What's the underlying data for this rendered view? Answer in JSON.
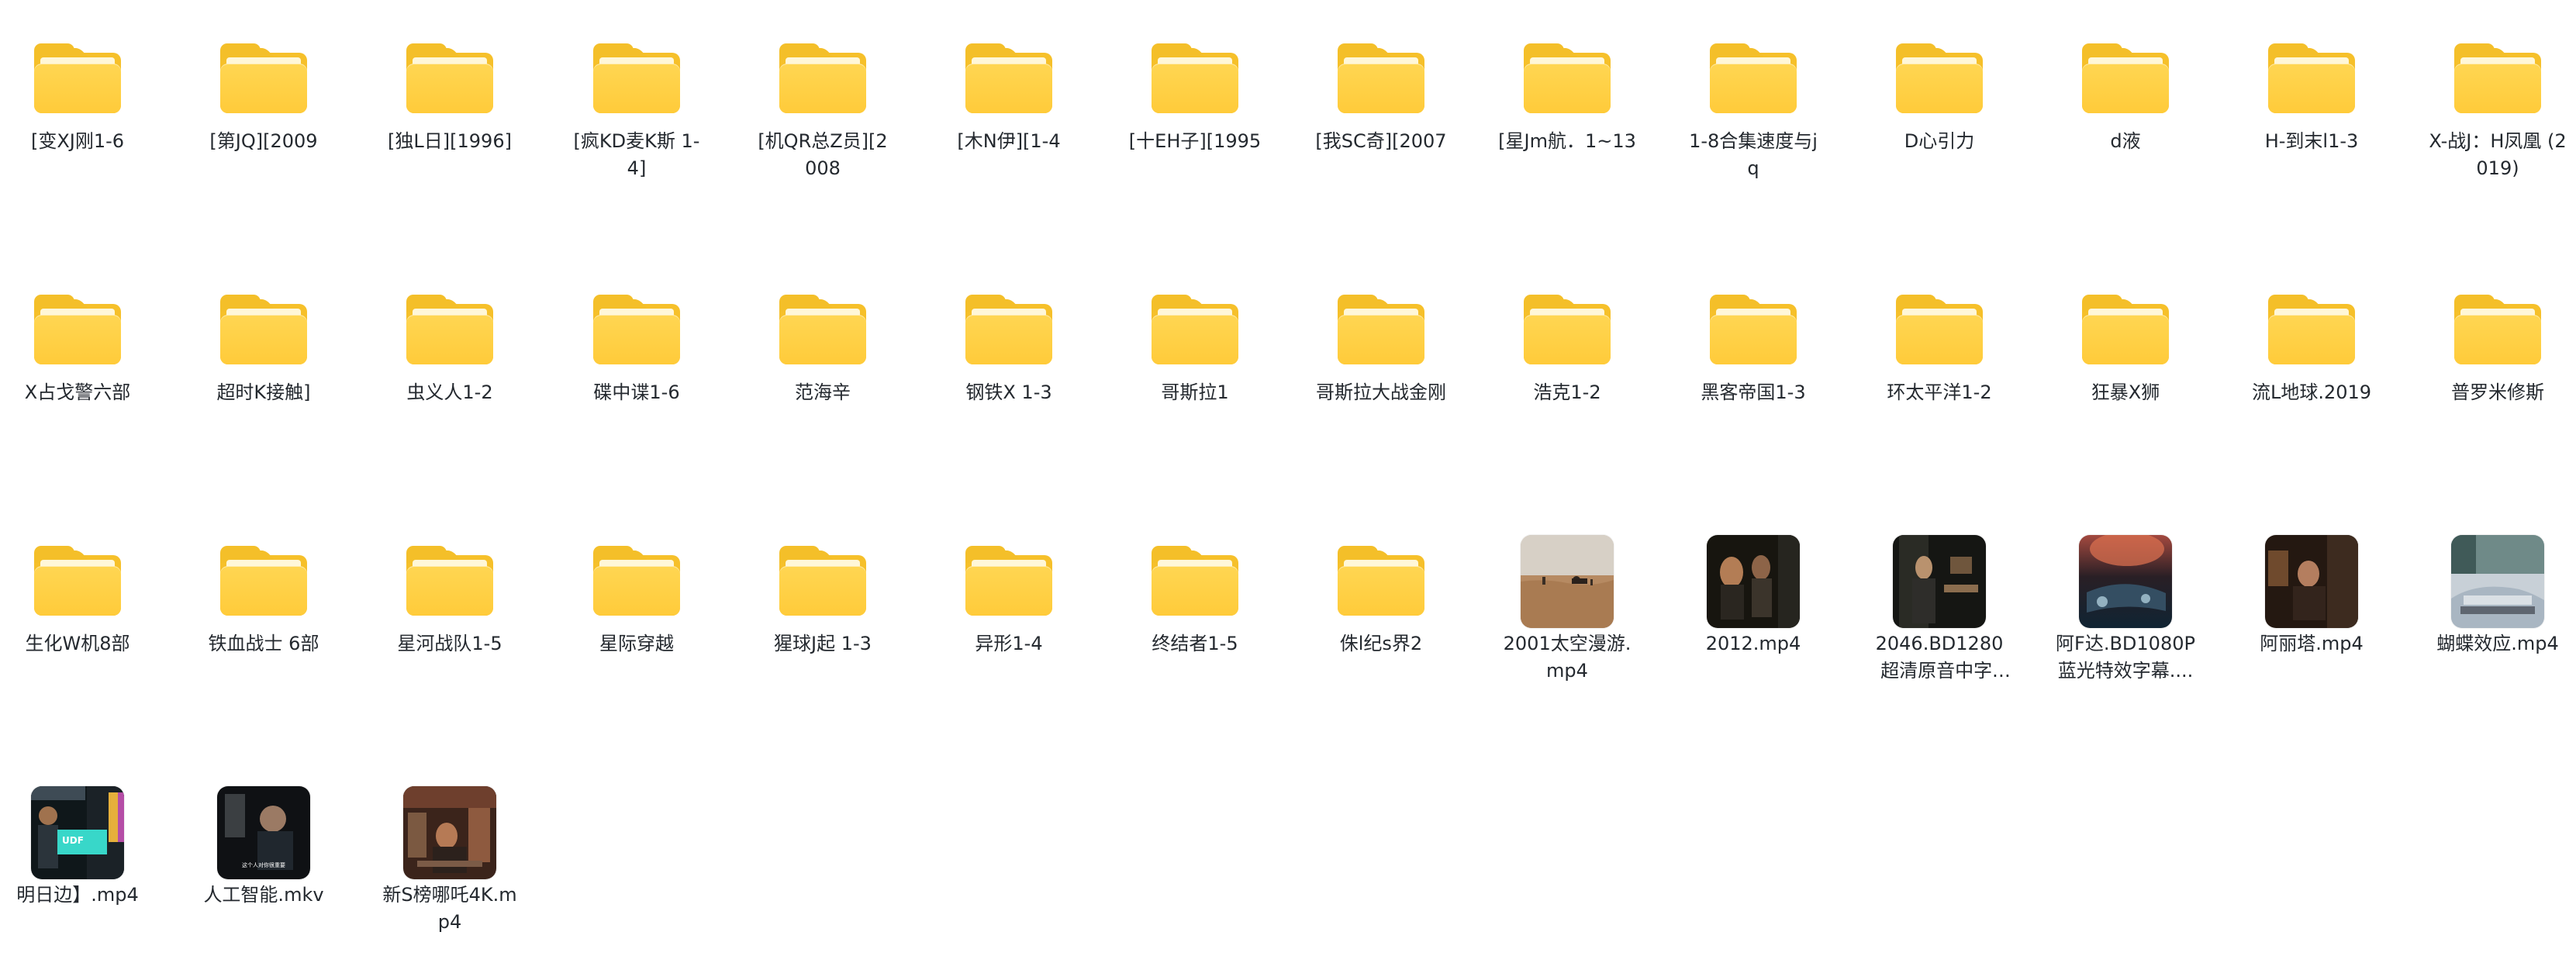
{
  "items": [
    {
      "label": "[变XJ刚1-6",
      "type": "folder"
    },
    {
      "label": "[第JQ][2009",
      "type": "folder"
    },
    {
      "label": "[独L日][1996]",
      "type": "folder"
    },
    {
      "label": "[疯KD麦K斯 1-4]",
      "type": "folder"
    },
    {
      "label": "[机QR总Z员][2008",
      "type": "folder"
    },
    {
      "label": "[木N伊][1-4",
      "type": "folder"
    },
    {
      "label": "[十EH子][1995",
      "type": "folder"
    },
    {
      "label": "[我SC奇][2007",
      "type": "folder"
    },
    {
      "label": "[星Jm航．1~13",
      "type": "folder"
    },
    {
      "label": "1-8合集速度与jq",
      "type": "folder"
    },
    {
      "label": "D心引力",
      "type": "folder"
    },
    {
      "label": "d液",
      "type": "folder"
    },
    {
      "label": "H-到末l1-3",
      "type": "folder"
    },
    {
      "label": "X-战J：H凤凰 (2019)",
      "type": "folder"
    },
    {
      "label": "X占戈警六部",
      "type": "folder"
    },
    {
      "label": "超时K接触]",
      "type": "folder"
    },
    {
      "label": "虫义人1-2",
      "type": "folder"
    },
    {
      "label": "碟中谍1-6",
      "type": "folder"
    },
    {
      "label": "范海辛",
      "type": "folder"
    },
    {
      "label": "钢铁X 1-3",
      "type": "folder"
    },
    {
      "label": "哥斯拉1",
      "type": "folder"
    },
    {
      "label": "哥斯拉大战金刚",
      "type": "folder"
    },
    {
      "label": "浩克1-2",
      "type": "folder"
    },
    {
      "label": "黑客帝国1-3",
      "type": "folder"
    },
    {
      "label": "环太平洋1-2",
      "type": "folder"
    },
    {
      "label": "狂暴X狮",
      "type": "folder"
    },
    {
      "label": "流L地球.2019",
      "type": "folder"
    },
    {
      "label": "普罗米修斯",
      "type": "folder"
    },
    {
      "label": "生化W机8部",
      "type": "folder"
    },
    {
      "label": "铁血战士 6部",
      "type": "folder"
    },
    {
      "label": "星河战队1-5",
      "type": "folder"
    },
    {
      "label": "星际穿越",
      "type": "folder"
    },
    {
      "label": "猩球J起 1-3",
      "type": "folder"
    },
    {
      "label": "异形1-4",
      "type": "folder"
    },
    {
      "label": "终结者1-5",
      "type": "folder"
    },
    {
      "label": "侏l纪s界2",
      "type": "folder"
    },
    {
      "label": "2001太空漫游.mp4",
      "type": "video",
      "theme": "desert"
    },
    {
      "label": "2012.mp4",
      "type": "video",
      "theme": "dark-faces"
    },
    {
      "label": "2046.BD1280超清原音中字.m...",
      "type": "video",
      "theme": "dark-cafe"
    },
    {
      "label": "阿F达.BD1080P蓝光特效字幕....",
      "type": "video",
      "theme": "blue-red"
    },
    {
      "label": "阿丽塔.mp4",
      "type": "video",
      "theme": "warm-interior"
    },
    {
      "label": "蝴蝶效应.mp4",
      "type": "video",
      "theme": "car"
    },
    {
      "label": "明日边】.mp4",
      "type": "video",
      "theme": "teal-screen"
    },
    {
      "label": "人工智能.mkv",
      "type": "video",
      "theme": "dark-man",
      "caption": "这个人对你很重要"
    },
    {
      "label": "新S榜哪吒4K.mp4",
      "type": "video",
      "theme": "studio"
    }
  ],
  "colors": {
    "folder": "#f6c02a",
    "folder_front": "#ffd652",
    "text": "#24292f",
    "background": "#ffffff"
  }
}
